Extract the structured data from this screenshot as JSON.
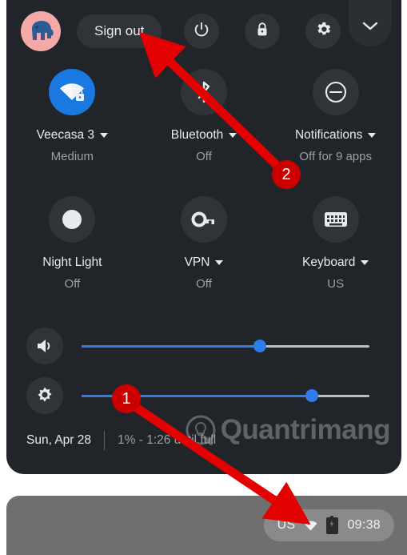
{
  "panel": {
    "account": {
      "avatar_icon": "elephant-avatar",
      "background_color": "#f4a9a8"
    },
    "sign_out_label": "Sign out",
    "buttons": [
      {
        "name": "power",
        "icon": "power-icon"
      },
      {
        "name": "lock",
        "icon": "lock-icon"
      },
      {
        "name": "settings",
        "icon": "gear-icon"
      },
      {
        "name": "collapse",
        "icon": "chevron-down-icon"
      }
    ],
    "tiles": [
      {
        "label": "Veecasa 3",
        "sub": "Medium",
        "icon": "wifi-locked-icon",
        "active": true,
        "has_caret": true
      },
      {
        "label": "Bluetooth",
        "sub": "Off",
        "icon": "bluetooth-icon",
        "active": false,
        "has_caret": true
      },
      {
        "label": "Notifications",
        "sub": "Off for 9 apps",
        "icon": "do-not-disturb-icon",
        "active": false,
        "has_caret": true
      },
      {
        "label": "Night Light",
        "sub": "Off",
        "icon": "moon-icon",
        "active": false,
        "has_caret": false
      },
      {
        "label": "VPN",
        "sub": "Off",
        "icon": "key-icon",
        "active": false,
        "has_caret": true
      },
      {
        "label": "Keyboard",
        "sub": "US",
        "icon": "keyboard-icon",
        "active": false,
        "has_caret": true
      }
    ],
    "sliders": [
      {
        "name": "volume",
        "icon": "speaker-icon",
        "value": 62
      },
      {
        "name": "brightness",
        "icon": "brightness-icon",
        "value": 80
      }
    ],
    "date": "Sun, Apr 28",
    "battery_status": "1% - 1:26 until full",
    "watermark": "Quantrimang"
  },
  "shelf": {
    "status": {
      "keyboard_layout": "US",
      "wifi_icon": "wifi-icon",
      "battery_icon": "battery-charging-icon",
      "clock": "09:38"
    }
  },
  "annotations": {
    "accent_color": "#cc0000",
    "markers": [
      {
        "number": "1",
        "target": "shelf-status-area"
      },
      {
        "number": "2",
        "target": "sign-out-button"
      }
    ]
  }
}
